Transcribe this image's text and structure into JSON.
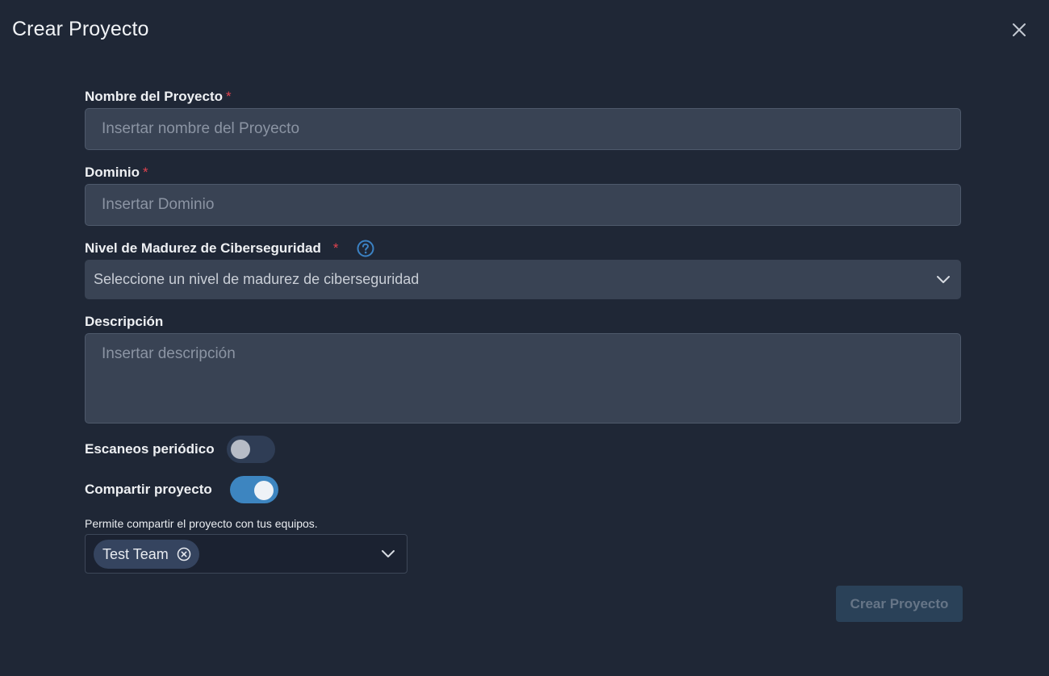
{
  "dialog": {
    "title": "Crear Proyecto"
  },
  "form": {
    "name": {
      "label": "Nombre del Proyecto",
      "required_mark": "*",
      "placeholder": "Insertar nombre del Proyecto",
      "value": ""
    },
    "domain": {
      "label": "Dominio",
      "required_mark": "*",
      "placeholder": "Insertar Dominio",
      "value": ""
    },
    "maturity": {
      "label": "Nivel de Madurez de Ciberseguridad",
      "required_mark": "*",
      "selected_text": "Seleccione un nivel de madurez de ciberseguridad",
      "help_icon": "question-circle-icon"
    },
    "description": {
      "label": "Descripción",
      "placeholder": "Insertar descripción",
      "value": ""
    },
    "periodic_scans": {
      "label": "Escaneos periódico",
      "enabled": false
    },
    "share_project": {
      "label": "Compartir proyecto",
      "enabled": true,
      "note": "Permite compartir el proyecto con tus equipos.",
      "selected_teams": [
        "Test Team"
      ]
    }
  },
  "actions": {
    "submit_label": "Crear Proyecto",
    "submit_disabled": true
  },
  "colors": {
    "background": "#1f2736",
    "field_bg": "#394354",
    "required": "#e0434f",
    "accent": "#3b82c4",
    "toggle_off": "#2f3d55",
    "toggle_on": "#3d85c0"
  }
}
